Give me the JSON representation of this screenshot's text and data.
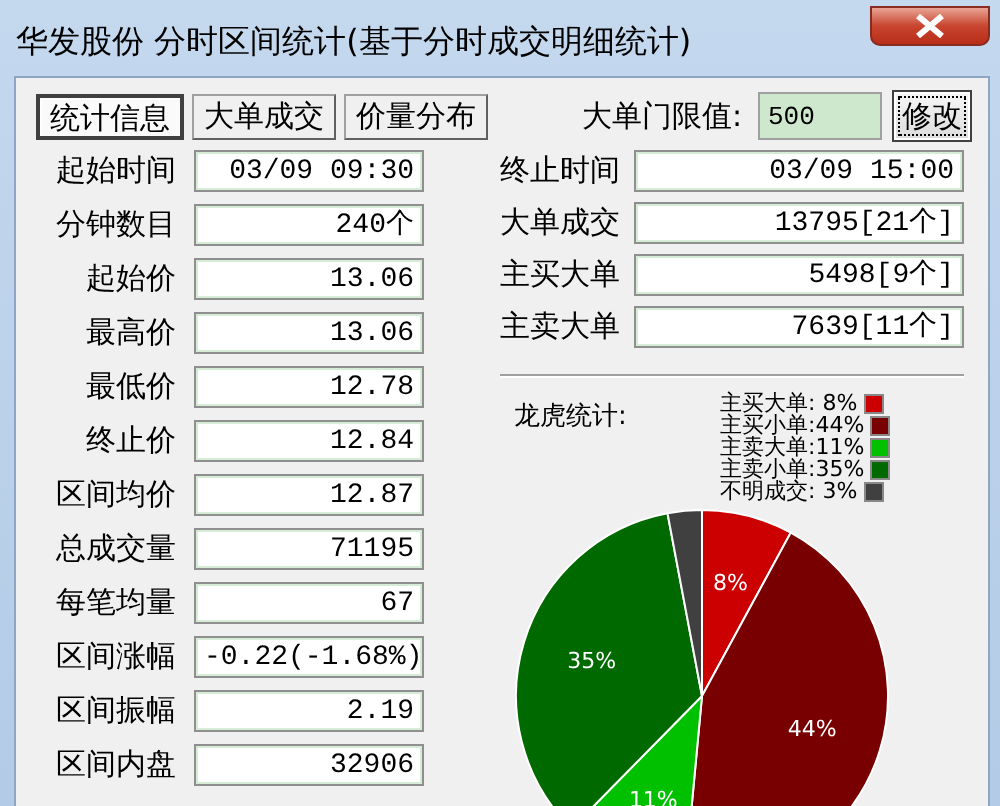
{
  "window": {
    "title": "华发股份 分时区间统计(基于分时成交明细统计)"
  },
  "tabs": [
    {
      "label": "统计信息",
      "selected": true
    },
    {
      "label": "大单成交",
      "selected": false
    },
    {
      "label": "价量分布",
      "selected": false
    }
  ],
  "threshold": {
    "label": "大单门限值:",
    "value": "500"
  },
  "modify_button": "修改",
  "left_fields": [
    {
      "label": "起始时间",
      "value": "03/09 09:30"
    },
    {
      "label": "分钟数目",
      "value": "240个"
    },
    {
      "label": "起始价",
      "value": "13.06"
    },
    {
      "label": "最高价",
      "value": "13.06"
    },
    {
      "label": "最低价",
      "value": "12.78"
    },
    {
      "label": "终止价",
      "value": "12.84"
    },
    {
      "label": "区间均价",
      "value": "12.87"
    },
    {
      "label": "总成交量",
      "value": "71195"
    },
    {
      "label": "每笔均量",
      "value": "67"
    },
    {
      "label": "区间涨幅",
      "value": "-0.22(-1.68%)"
    },
    {
      "label": "区间振幅",
      "value": "2.19"
    },
    {
      "label": "区间内盘",
      "value": "32906"
    }
  ],
  "right_fields": [
    {
      "label": "终止时间",
      "value": "03/09 15:00"
    },
    {
      "label": "大单成交",
      "value": "13795[21个]"
    },
    {
      "label": "主买大单",
      "value": "5498[9个]"
    },
    {
      "label": "主卖大单",
      "value": "7639[11个]"
    }
  ],
  "chart": {
    "title": "龙虎统计:",
    "legend": [
      {
        "label": "主买大单: 8%",
        "color": "#cc0000"
      },
      {
        "label": "主买小单:44%",
        "color": "#780000"
      },
      {
        "label": "主卖大单:11%",
        "color": "#00c000"
      },
      {
        "label": "主卖小单:35%",
        "color": "#006a00"
      },
      {
        "label": "不明成交: 3%",
        "color": "#404040"
      }
    ],
    "chart_data": {
      "type": "pie",
      "values": [
        8,
        44,
        11,
        35,
        3
      ],
      "value_labels": [
        "8%",
        "44%",
        "11%",
        "35%",
        null
      ]
    }
  }
}
